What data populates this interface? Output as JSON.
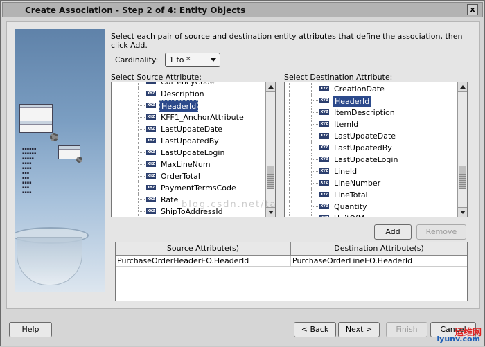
{
  "window": {
    "title": "Create Association - Step 2 of 4: Entity Objects",
    "close_glyph": "x"
  },
  "instructions": "Select each pair of source and destination entity attributes that define the association, then click Add.",
  "cardinality": {
    "label": "Cardinality:",
    "value": "1 to *"
  },
  "source": {
    "label": "Select Source Attribute:",
    "partial_top": "CurrencyCode",
    "items": [
      "Description",
      "HeaderId",
      "KFF1_AnchorAttribute",
      "LastUpdateDate",
      "LastUpdatedBy",
      "LastUpdateLogin",
      "MaxLineNum",
      "OrderTotal",
      "PaymentTermsCode",
      "Rate",
      "ShipToAddressId"
    ],
    "selected": "HeaderId"
  },
  "destination": {
    "label": "Select Destination Attribute:",
    "items": [
      "CreationDate",
      "HeaderId",
      "ItemDescription",
      "ItemId",
      "LastUpdateDate",
      "LastUpdatedBy",
      "LastUpdateLogin",
      "LineId",
      "LineNumber",
      "LineTotal",
      "Quantity"
    ],
    "partial_bottom": "UnitOfMeasure",
    "selected": "HeaderId"
  },
  "icon_badge": "XYZ",
  "buttons": {
    "add": "Add",
    "remove": "Remove",
    "help": "Help",
    "back": "< Back",
    "next": "Next >",
    "finish": "Finish",
    "cancel": "Cancel"
  },
  "table": {
    "headers": [
      "Source Attribute(s)",
      "Destination Attribute(s)"
    ],
    "rows": [
      [
        "PurchaseOrderHeaderEO.HeaderId",
        "PurchaseOrderLineEO.HeaderId"
      ]
    ]
  },
  "watermark": {
    "blog": "blog.csdn.net/ta",
    "logo_cn": "运维网",
    "logo_en": "iyunv.com"
  }
}
